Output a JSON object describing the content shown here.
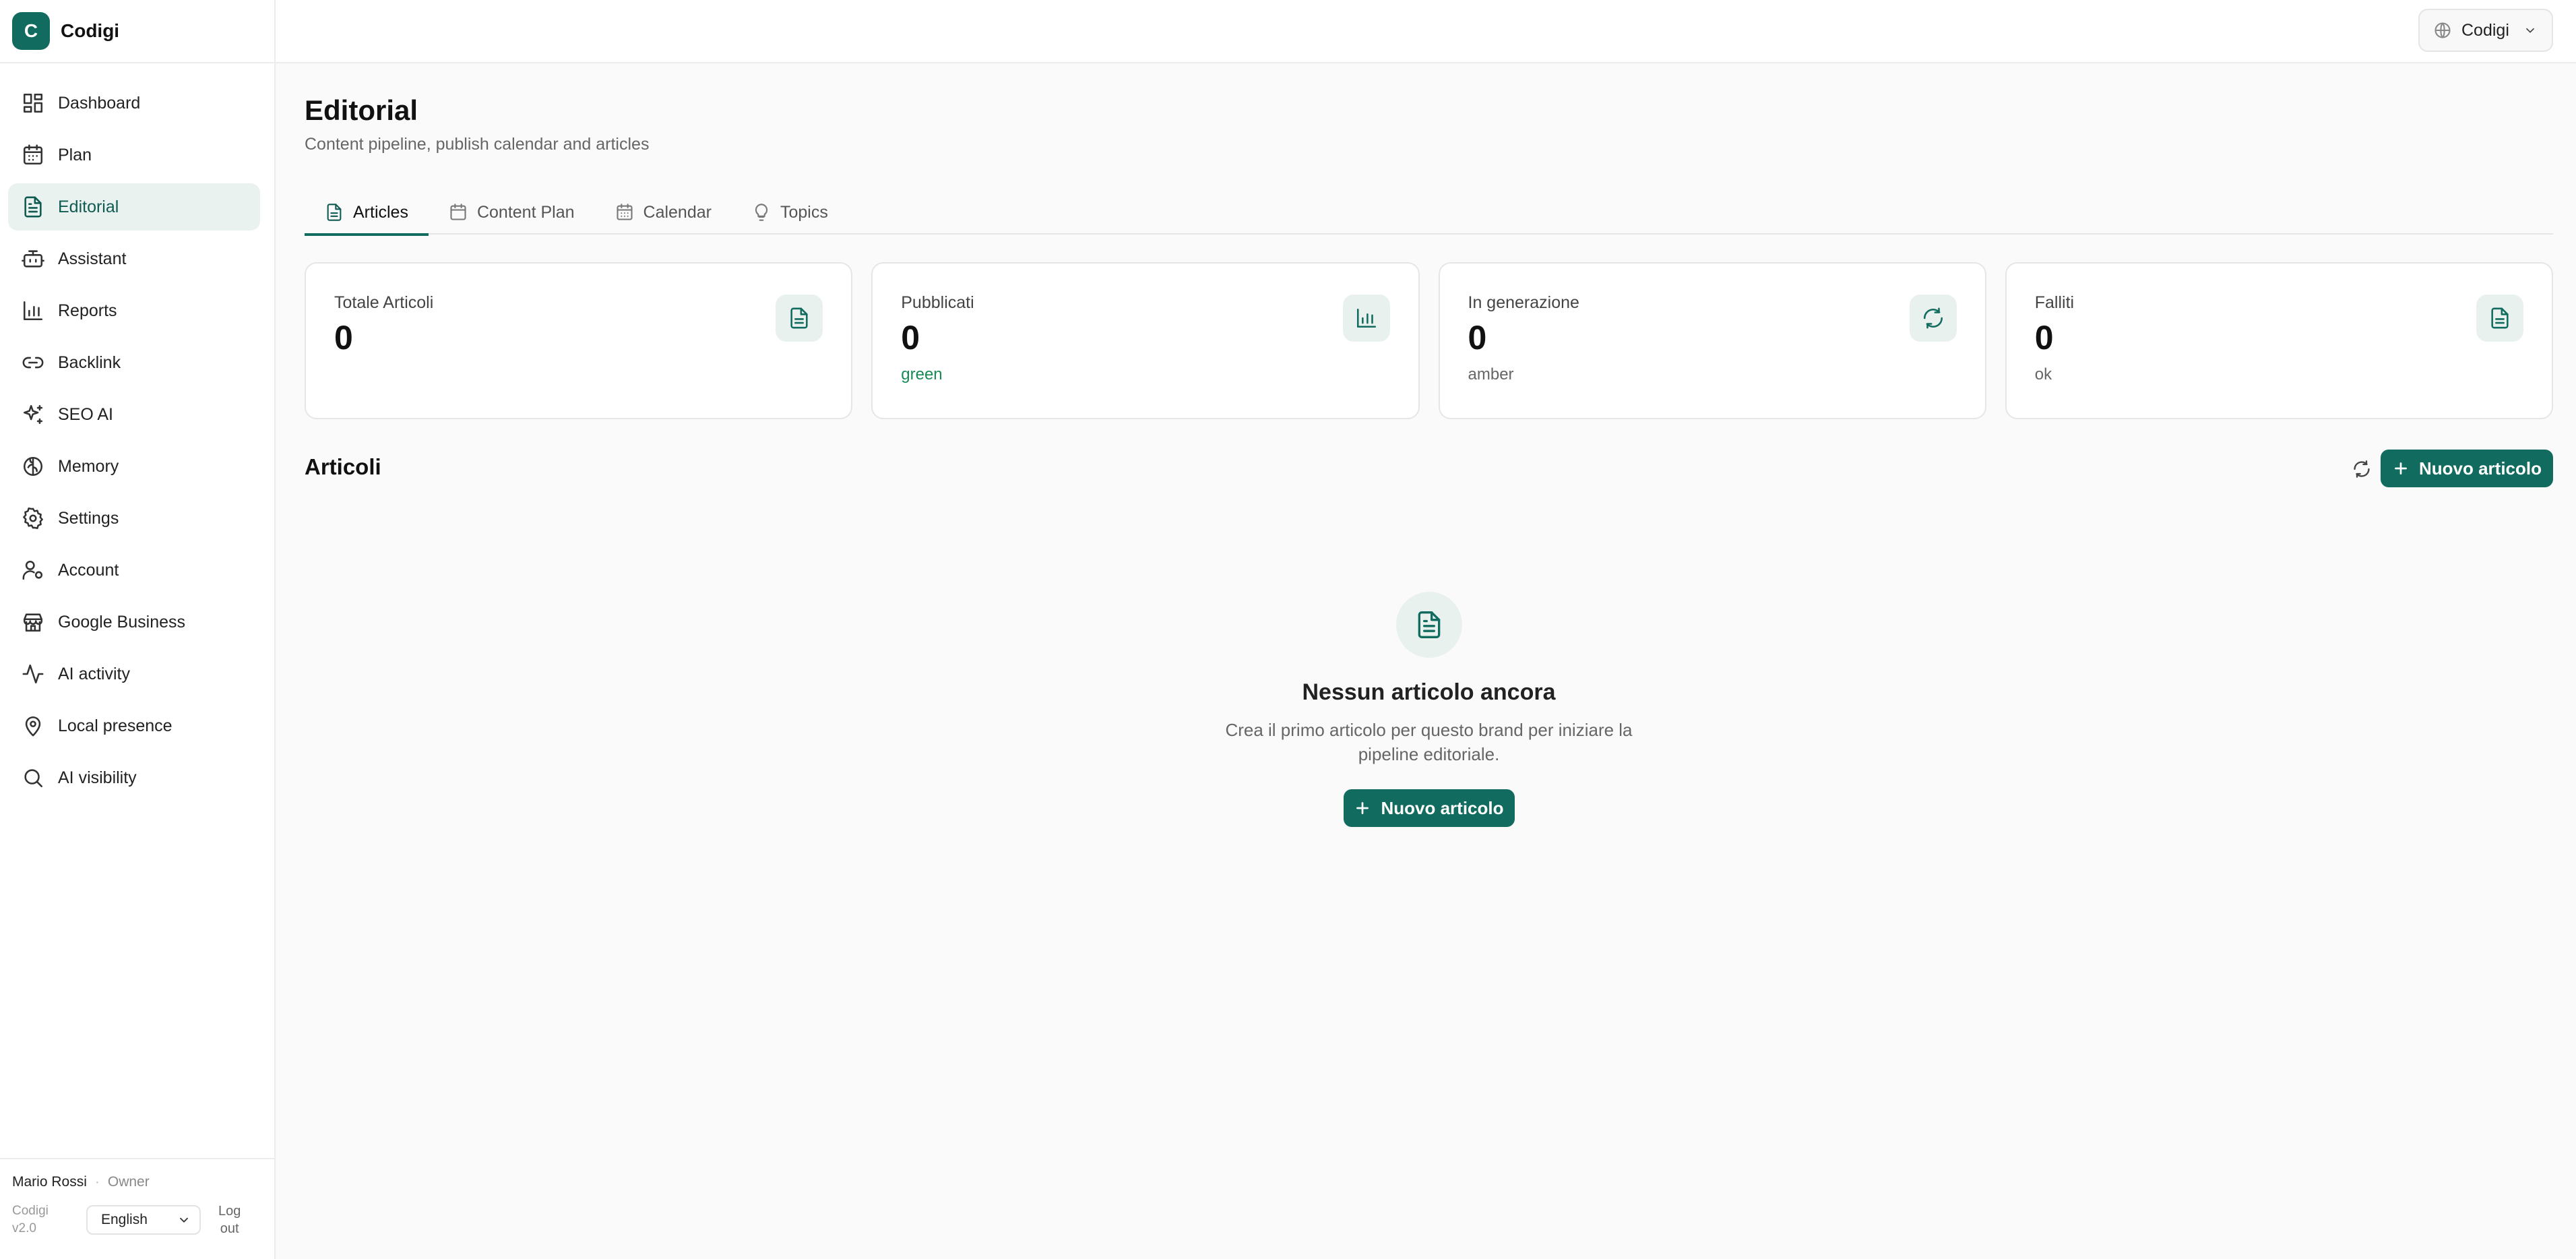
{
  "brand": {
    "initial": "C",
    "name": "Codigi"
  },
  "sidebar": {
    "items": [
      {
        "label": "Dashboard",
        "icon": "dashboard-icon"
      },
      {
        "label": "Plan",
        "icon": "calendar-icon"
      },
      {
        "label": "Editorial",
        "icon": "file-text-icon",
        "active": true
      },
      {
        "label": "Assistant",
        "icon": "bot-icon"
      },
      {
        "label": "Reports",
        "icon": "bar-chart-icon"
      },
      {
        "label": "Backlink",
        "icon": "link-icon"
      },
      {
        "label": "SEO AI",
        "icon": "sparkles-icon"
      },
      {
        "label": "Memory",
        "icon": "brain-icon"
      },
      {
        "label": "Settings",
        "icon": "gear-icon"
      },
      {
        "label": "Account",
        "icon": "user-cog-icon"
      },
      {
        "label": "Google Business",
        "icon": "store-icon"
      },
      {
        "label": "AI activity",
        "icon": "activity-icon"
      },
      {
        "label": "Local presence",
        "icon": "map-pin-icon"
      },
      {
        "label": "AI visibility",
        "icon": "search-icon"
      }
    ],
    "footer": {
      "user_name": "Mario Rossi",
      "separator": "·",
      "role": "Owner",
      "version_line1": "Codigi",
      "version_line2": "v2.0",
      "language": "English",
      "logout_line1": "Log",
      "logout_line2": "out"
    }
  },
  "topbar": {
    "brand_selector": "Codigi"
  },
  "page": {
    "title": "Editorial",
    "subtitle": "Content pipeline, publish calendar and articles"
  },
  "tabs": [
    {
      "label": "Articles",
      "icon": "file-text-icon",
      "active": true
    },
    {
      "label": "Content Plan",
      "icon": "calendar-icon"
    },
    {
      "label": "Calendar",
      "icon": "calendar-days-icon"
    },
    {
      "label": "Topics",
      "icon": "lightbulb-icon"
    }
  ],
  "stats": [
    {
      "label": "Totale Articoli",
      "value": "0",
      "note": "",
      "icon": "file-text-icon"
    },
    {
      "label": "Pubblicati",
      "value": "0",
      "note": "green",
      "icon": "bar-chart-icon"
    },
    {
      "label": "In generazione",
      "value": "0",
      "note": "amber",
      "icon": "refresh-icon"
    },
    {
      "label": "Falliti",
      "value": "0",
      "note": "ok",
      "icon": "file-text-icon"
    }
  ],
  "articles": {
    "title": "Articoli",
    "new_button": "Nuovo articolo",
    "empty": {
      "title": "Nessun articolo ancora",
      "description": "Crea il primo articolo per questo brand per iniziare la pipeline editoriale.",
      "button": "Nuovo articolo"
    }
  },
  "colors": {
    "accent": "#116b5f",
    "active_bg": "#eaf2f0",
    "success": "#178a55"
  }
}
